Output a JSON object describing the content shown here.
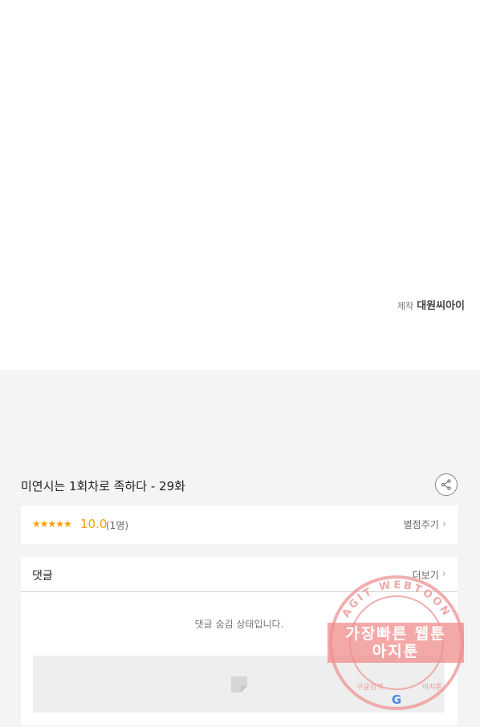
{
  "credit": {
    "label": "제작",
    "name": "대원씨아이"
  },
  "episode": {
    "title": "미연시는 1회차로 족하다 - 29화"
  },
  "rating": {
    "stars": "★★★★★",
    "score": "10.0",
    "count": "(1명)",
    "rate_link": "별점주기",
    "value_out_of_10": 10.0
  },
  "comments": {
    "title": "댓글",
    "more_link": "더보기",
    "hidden_message": "댓글 숨김 상태입니다."
  },
  "watermark": {
    "ring_text": "AGIT WEBTOON",
    "band_line1": "가장빠른 웹툰",
    "band_line2": "아지툰",
    "bottom_left": "구글검색",
    "bottom_right": "아지툰",
    "bottom_logo": "G"
  },
  "colors": {
    "accent": "#f5a000",
    "stamp": "#e88080"
  }
}
